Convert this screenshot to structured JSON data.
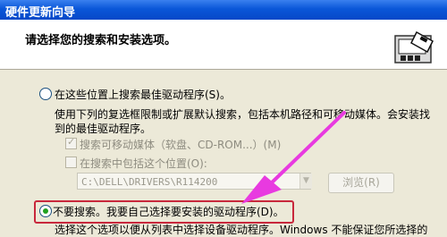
{
  "window": {
    "title": "硬件更新向导"
  },
  "header": {
    "title": "请选择您的搜索和安装选项。",
    "icon": "hardware-card-icon"
  },
  "options": {
    "search": {
      "label": "在这些位置上搜索最佳驱动程序(S)。",
      "description_line1": "使用下列的复选框限制或扩展默认搜索，包括本机路径和可移动媒体。会安装找",
      "description_line2": "到的最佳驱动程序。",
      "selected": false
    },
    "removable_media": {
      "label": "搜索可移动媒体（软盘、CD-ROM...）(M)",
      "checked": true,
      "enabled": false
    },
    "include_location": {
      "label": "在搜索中包括这个位置(O):",
      "checked": false,
      "enabled": false
    },
    "path": {
      "value": "C:\\DELL\\DRIVERS\\R114200"
    },
    "browse_button": {
      "label": "浏览(R)"
    },
    "dont_search": {
      "label": "不要搜索。我要自己选择要安装的驱动程序(D)。",
      "selected": true,
      "description_partial": "选择这个选项以便从列表中选择设备驱动程序。Windows 不能保证您所选择的"
    }
  },
  "colors": {
    "annotation_box": "#c8283c",
    "annotation_arrow": "#e83ae0",
    "title_bar": "#0a57d8"
  }
}
